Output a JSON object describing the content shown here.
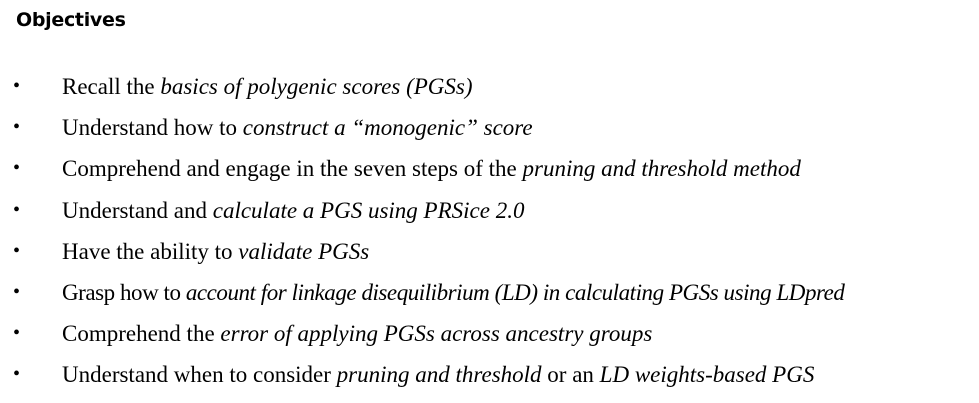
{
  "heading": "Objectives",
  "bullet": "•",
  "objectives": [
    {
      "segments": [
        {
          "text": "Recall the ",
          "italic": false
        },
        {
          "text": "basics of polygenic scores (PGSs)",
          "italic": true
        }
      ]
    },
    {
      "segments": [
        {
          "text": "Understand how to ",
          "italic": false
        },
        {
          "text": "construct a “monogenic” score",
          "italic": true
        }
      ]
    },
    {
      "segments": [
        {
          "text": "Comprehend and engage in the seven steps of the ",
          "italic": false
        },
        {
          "text": "pruning and threshold method",
          "italic": true
        }
      ]
    },
    {
      "segments": [
        {
          "text": "Understand and ",
          "italic": false
        },
        {
          "text": "calculate a PGS using PRSice 2.0",
          "italic": true
        }
      ]
    },
    {
      "segments": [
        {
          "text": "Have the ability to ",
          "italic": false
        },
        {
          "text": "validate PGSs",
          "italic": true
        }
      ]
    },
    {
      "segments": [
        {
          "text": "Grasp how to ",
          "italic": false
        },
        {
          "text": "account for linkage disequilibrium (LD) in calculating PGSs using LDpred",
          "italic": true
        }
      ]
    },
    {
      "segments": [
        {
          "text": "Comprehend the ",
          "italic": false
        },
        {
          "text": "error of applying PGSs across ancestry groups",
          "italic": true
        }
      ]
    },
    {
      "segments": [
        {
          "text": "Understand when to consider ",
          "italic": false
        },
        {
          "text": "pruning and threshold",
          "italic": true
        },
        {
          "text": " or an ",
          "italic": false
        },
        {
          "text": "LD weights-based PGS",
          "italic": true
        }
      ]
    }
  ]
}
